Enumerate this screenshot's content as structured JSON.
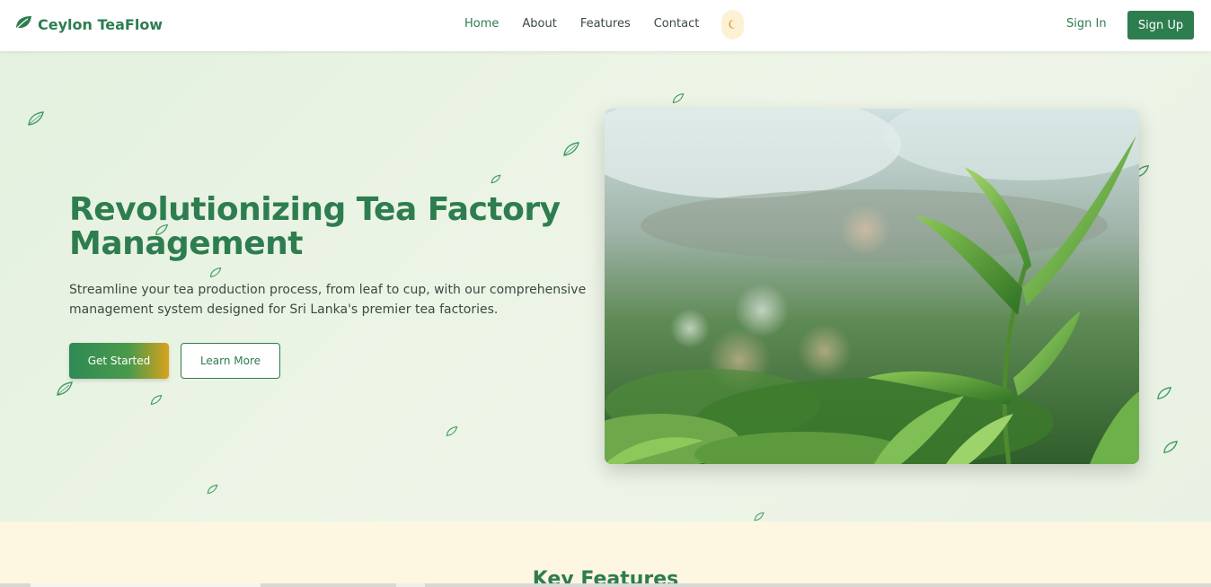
{
  "brand": {
    "name": "Ceylon TeaFlow",
    "icon": "leaf-icon",
    "color": "#2e7d4f"
  },
  "nav": {
    "links": [
      {
        "label": "Home",
        "active": true
      },
      {
        "label": "About",
        "active": false
      },
      {
        "label": "Features",
        "active": false
      },
      {
        "label": "Contact",
        "active": false
      }
    ],
    "theme_toggle_icon": "moon-icon",
    "signin_label": "Sign In",
    "signup_label": "Sign Up"
  },
  "hero": {
    "title": "Revolutionizing Tea Factory Management",
    "subtitle": "Streamline your tea production process, from leaf to cup, with our comprehensive management system designed for Sri Lanka's premier tea factories.",
    "primary_cta": "Get Started",
    "secondary_cta": "Learn More",
    "image_alt": "tea-leaves-photo"
  },
  "features": {
    "title": "Key Features"
  },
  "colors": {
    "accent": "#2e7d4f",
    "hero_bg": "#e8f2e2",
    "features_bg": "#fdf6e0",
    "cta_gradient_end": "#d8a21c"
  }
}
